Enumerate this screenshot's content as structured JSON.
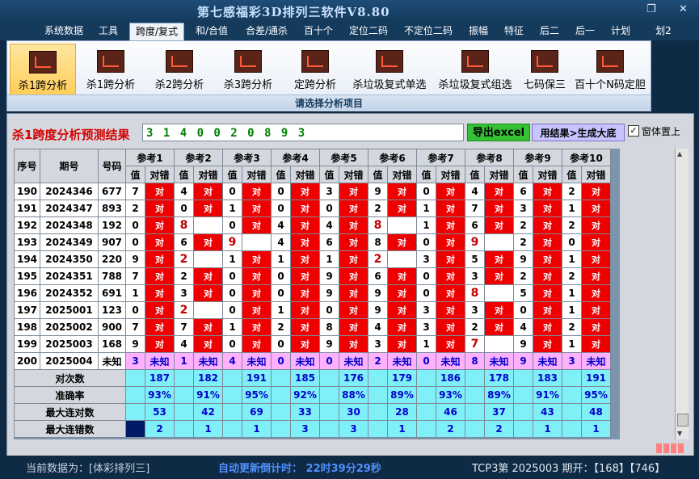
{
  "window": {
    "title": "第七感福彩3D排列三软件V8.80",
    "restore": "❐",
    "close": "✕"
  },
  "menu": [
    "系统数据",
    "工具",
    "跨度/复式",
    "和/合值",
    "合差/通杀",
    "百十个",
    "定位二码",
    "不定位二码",
    "振幅",
    "特征",
    "后二",
    "后一",
    "计划",
    "划2"
  ],
  "ribbon": {
    "buttons": [
      "杀1跨分析",
      "杀1跨分析",
      "杀2跨分析",
      "杀3跨分析",
      "定跨分析",
      "杀垃圾复式单选",
      "杀垃圾复式组选",
      "七码保三",
      "百十个N码定胆"
    ],
    "caption": "请选择分析项目"
  },
  "panel": {
    "result_label": "杀1跨度分析预测结果",
    "result_value": "3 1 4 0 0 2 0 8 9 3",
    "export_button": "导出excel",
    "generate_button": "用结果>生成大底",
    "checkbox_checked": "✓",
    "checkbox_label": "窗体置上"
  },
  "table": {
    "head_cols": [
      "序号",
      "期号",
      "号码"
    ],
    "refs": [
      "参考1",
      "参考2",
      "参考3",
      "参考4",
      "参考5",
      "参考6",
      "参考7",
      "参考8",
      "参考9",
      "参考10"
    ],
    "sub_val": "值",
    "sub_ok": "对错",
    "ok_text": "对",
    "rows": [
      {
        "seq": "190",
        "issue": "2024346",
        "num": "677",
        "cells": [
          [
            "7",
            1
          ],
          [
            "4",
            1
          ],
          [
            "0",
            1
          ],
          [
            "0",
            1
          ],
          [
            "3",
            1
          ],
          [
            "9",
            1
          ],
          [
            "0",
            1
          ],
          [
            "4",
            1
          ],
          [
            "6",
            1
          ],
          [
            "2",
            1
          ]
        ]
      },
      {
        "seq": "191",
        "issue": "2024347",
        "num": "893",
        "cells": [
          [
            "2",
            1
          ],
          [
            "0",
            1
          ],
          [
            "1",
            1
          ],
          [
            "0",
            1
          ],
          [
            "0",
            1
          ],
          [
            "2",
            1
          ],
          [
            "1",
            1
          ],
          [
            "7",
            1
          ],
          [
            "3",
            1
          ],
          [
            "1",
            1
          ]
        ]
      },
      {
        "seq": "192",
        "issue": "2024348",
        "num": "192",
        "cells": [
          [
            "0",
            1
          ],
          [
            "8",
            0
          ],
          [
            "0",
            1
          ],
          [
            "4",
            1
          ],
          [
            "4",
            1
          ],
          [
            "8",
            0
          ],
          [
            "1",
            1
          ],
          [
            "6",
            1
          ],
          [
            "2",
            1
          ],
          [
            "2",
            1
          ]
        ]
      },
      {
        "seq": "193",
        "issue": "2024349",
        "num": "907",
        "cells": [
          [
            "0",
            1
          ],
          [
            "6",
            1
          ],
          [
            "9",
            0
          ],
          [
            "4",
            1
          ],
          [
            "6",
            1
          ],
          [
            "8",
            1
          ],
          [
            "0",
            1
          ],
          [
            "9",
            0
          ],
          [
            "2",
            1
          ],
          [
            "0",
            1
          ]
        ]
      },
      {
        "seq": "194",
        "issue": "2024350",
        "num": "220",
        "cells": [
          [
            "9",
            1
          ],
          [
            "2",
            0
          ],
          [
            "1",
            1
          ],
          [
            "1",
            1
          ],
          [
            "1",
            1
          ],
          [
            "2",
            0
          ],
          [
            "3",
            1
          ],
          [
            "5",
            1
          ],
          [
            "9",
            1
          ],
          [
            "1",
            1
          ]
        ]
      },
      {
        "seq": "195",
        "issue": "2024351",
        "num": "788",
        "cells": [
          [
            "7",
            1
          ],
          [
            "2",
            1
          ],
          [
            "0",
            1
          ],
          [
            "0",
            1
          ],
          [
            "9",
            1
          ],
          [
            "6",
            1
          ],
          [
            "0",
            1
          ],
          [
            "3",
            1
          ],
          [
            "2",
            1
          ],
          [
            "2",
            1
          ]
        ]
      },
      {
        "seq": "196",
        "issue": "2024352",
        "num": "691",
        "cells": [
          [
            "1",
            1
          ],
          [
            "3",
            1
          ],
          [
            "0",
            1
          ],
          [
            "0",
            1
          ],
          [
            "9",
            1
          ],
          [
            "9",
            1
          ],
          [
            "0",
            1
          ],
          [
            "8",
            0
          ],
          [
            "5",
            1
          ],
          [
            "1",
            1
          ]
        ]
      },
      {
        "seq": "197",
        "issue": "2025001",
        "num": "123",
        "cells": [
          [
            "0",
            1
          ],
          [
            "2",
            0
          ],
          [
            "0",
            1
          ],
          [
            "1",
            1
          ],
          [
            "0",
            1
          ],
          [
            "9",
            1
          ],
          [
            "3",
            1
          ],
          [
            "3",
            1
          ],
          [
            "0",
            1
          ],
          [
            "1",
            1
          ]
        ]
      },
      {
        "seq": "198",
        "issue": "2025002",
        "num": "900",
        "cells": [
          [
            "7",
            1
          ],
          [
            "7",
            1
          ],
          [
            "1",
            1
          ],
          [
            "2",
            1
          ],
          [
            "8",
            1
          ],
          [
            "4",
            1
          ],
          [
            "3",
            1
          ],
          [
            "2",
            1
          ],
          [
            "4",
            1
          ],
          [
            "2",
            1
          ]
        ]
      },
      {
        "seq": "199",
        "issue": "2025003",
        "num": "168",
        "cells": [
          [
            "9",
            1
          ],
          [
            "4",
            1
          ],
          [
            "0",
            1
          ],
          [
            "0",
            1
          ],
          [
            "9",
            1
          ],
          [
            "3",
            1
          ],
          [
            "1",
            1
          ],
          [
            "7",
            0
          ],
          [
            "9",
            1
          ],
          [
            "1",
            1
          ]
        ]
      }
    ],
    "predict": {
      "seq": "200",
      "issue": "2025004",
      "num": "未知",
      "vals": [
        "3",
        "1",
        "4",
        "0",
        "0",
        "2",
        "0",
        "8",
        "9",
        "3"
      ],
      "unknown": "未知"
    },
    "stats": [
      {
        "label": "对次数",
        "vals": [
          "187",
          "182",
          "191",
          "185",
          "176",
          "179",
          "186",
          "178",
          "183",
          "191"
        ]
      },
      {
        "label": "准确率",
        "vals": [
          "93%",
          "91%",
          "95%",
          "92%",
          "88%",
          "89%",
          "93%",
          "89%",
          "91%",
          "95%"
        ]
      },
      {
        "label": "最大连对数",
        "vals": [
          "53",
          "42",
          "69",
          "33",
          "30",
          "28",
          "46",
          "37",
          "43",
          "48"
        ]
      },
      {
        "label": "最大连错数",
        "vals": [
          "2",
          "1",
          "1",
          "3",
          "3",
          "1",
          "2",
          "2",
          "1",
          "1"
        ]
      }
    ]
  },
  "status": {
    "current": "当前数据为：[体彩排列三]",
    "countdown": "自动更新倒计时： 22时39分29秒",
    "draw": "TCP3第 2025003 期开：【168】【746】"
  }
}
